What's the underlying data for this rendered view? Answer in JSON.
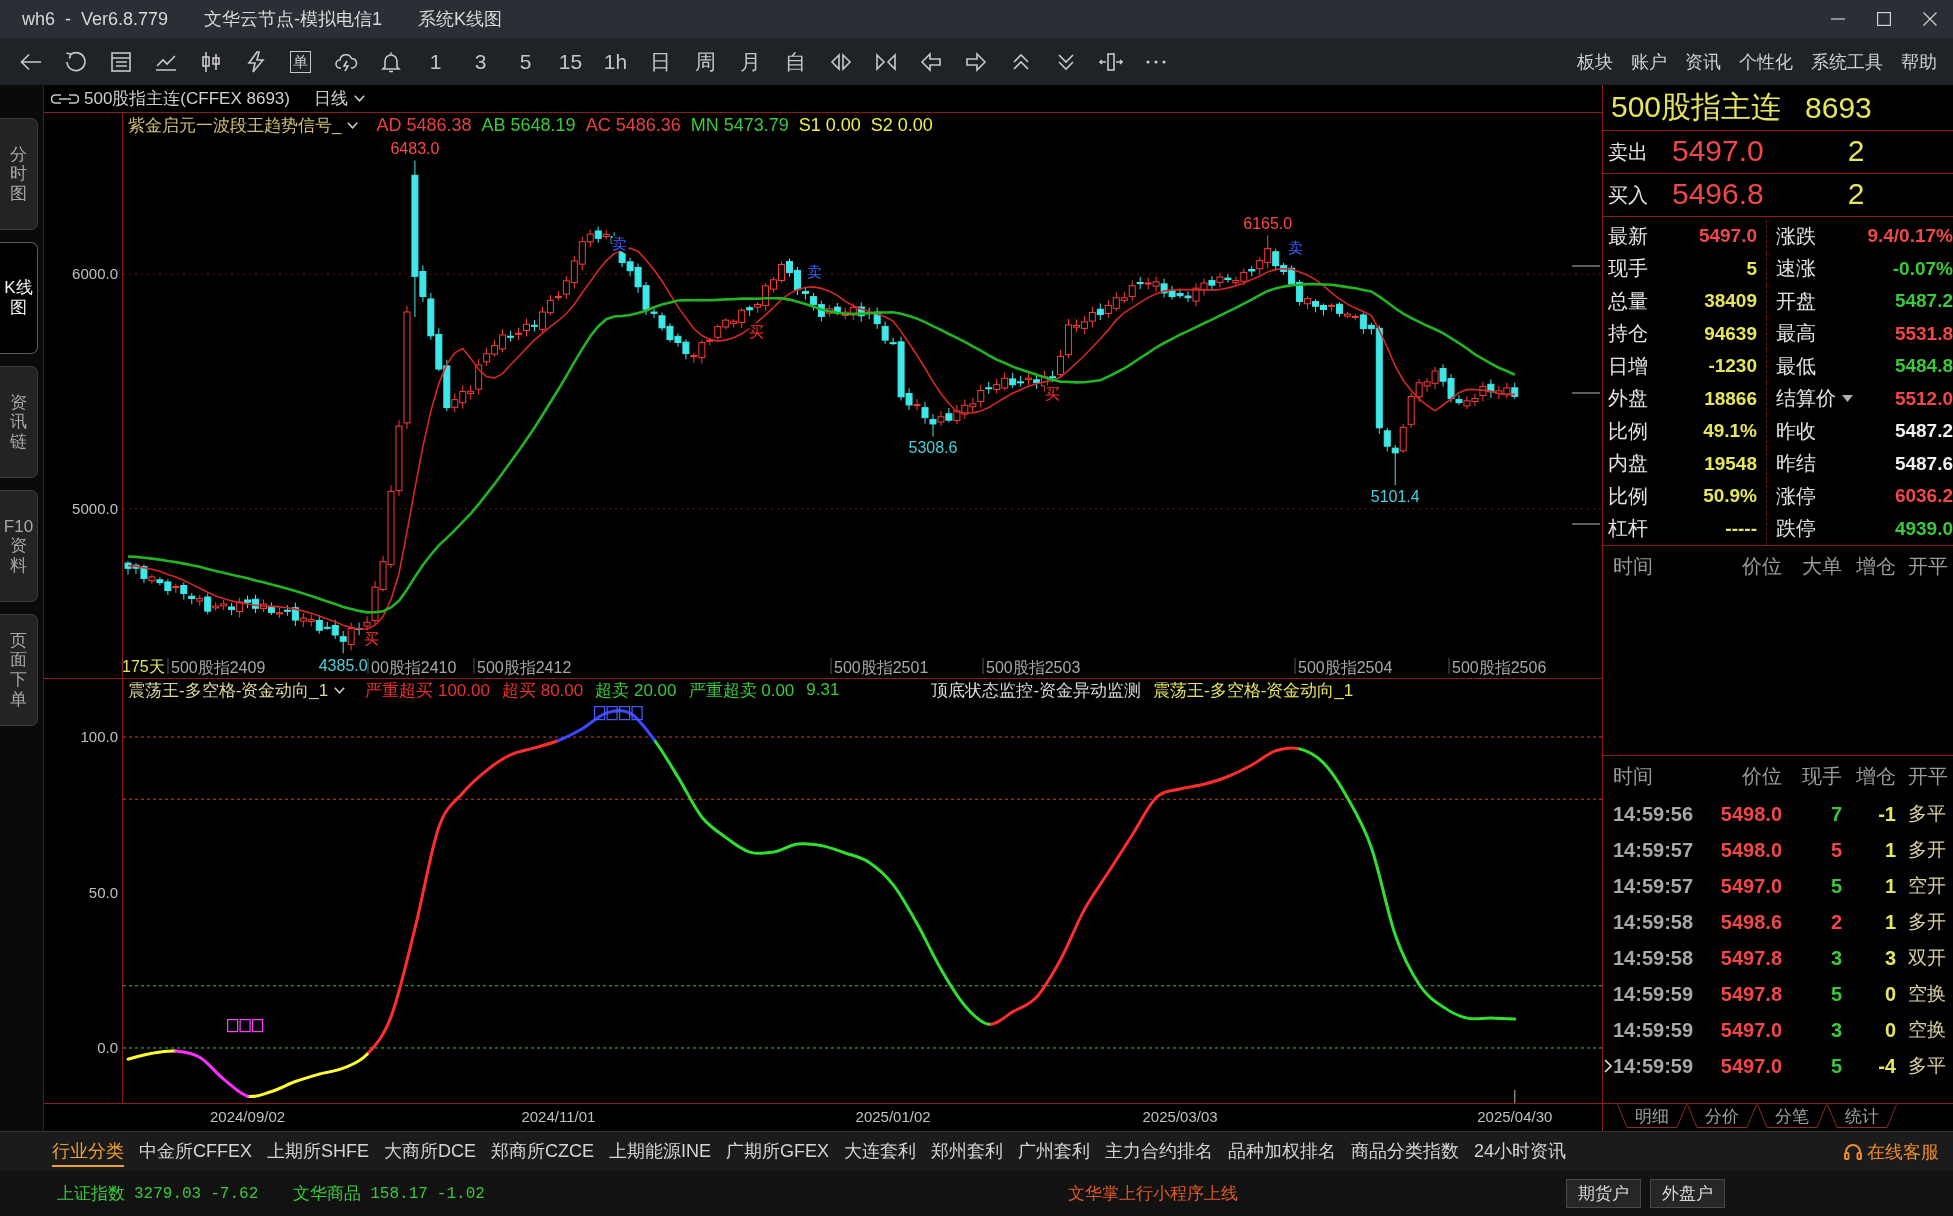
{
  "window": {
    "title_parts": [
      "wh6  -  Ver6.8.779",
      "文华云节点-模拟电信1",
      "系统K线图"
    ]
  },
  "toolbar": {
    "order_label": "单",
    "periods": [
      "1",
      "3",
      "5",
      "15",
      "1h",
      "日",
      "周",
      "月",
      "自"
    ],
    "menu": [
      "板块",
      "账户",
      "资讯",
      "个性化",
      "系统工具",
      "帮助"
    ]
  },
  "side_tabs": [
    {
      "label": "分时图",
      "selected": false
    },
    {
      "label": "K线图",
      "selected": true
    },
    {
      "label": "资讯链",
      "selected": false
    },
    {
      "label": "F10资料",
      "selected": false
    },
    {
      "label": "页面下单",
      "selected": false
    }
  ],
  "chart_header": {
    "symbol": "500股指主连(CFFEX 8693)",
    "period": "日线"
  },
  "main_chart": {
    "indicator": "紫金启元一波段王趋势信号_",
    "values": [
      {
        "text": "AD 5486.38",
        "color": "#e84040"
      },
      {
        "text": "AB 5648.19",
        "color": "#3cc83c"
      },
      {
        "text": "AC 5486.36",
        "color": "#e84040"
      },
      {
        "text": "MN 5473.79",
        "color": "#3cc83c"
      },
      {
        "text": "S1 0.00",
        "color": "#f0f040"
      },
      {
        "text": "S2 0.00",
        "color": "#f0f040"
      }
    ],
    "y_labels": [
      "6000.0",
      "5000.0"
    ],
    "bar_count": "175天",
    "contracts": [
      "500股指2409",
      "00股指2410",
      "500股指2412",
      "500股指2501",
      "500股指2503",
      "500股指2504",
      "500股指2506"
    ],
    "price_labels": [
      {
        "text": "6483.0",
        "kind": "high"
      },
      {
        "text": "4385.0",
        "kind": "low"
      },
      {
        "text": "5308.6",
        "kind": "low"
      },
      {
        "text": "6165.0",
        "kind": "high"
      },
      {
        "text": "5101.4",
        "kind": "low"
      }
    ],
    "signals": [
      {
        "text": "买",
        "kind": "buy"
      },
      {
        "text": "卖",
        "kind": "sell"
      },
      {
        "text": "买",
        "kind": "buy"
      },
      {
        "text": "卖",
        "kind": "sell"
      },
      {
        "text": "买",
        "kind": "buy"
      },
      {
        "text": "卖",
        "kind": "sell"
      }
    ]
  },
  "sub_chart": {
    "chart_data": {
      "type": "line",
      "title": "震荡王-多空格-资金动向_1",
      "categories": [
        null,
        null,
        null,
        null,
        null,
        "2024/09/02",
        null,
        null,
        null,
        null,
        null,
        null,
        null,
        null,
        null,
        null,
        null,
        null,
        "2024/11/01",
        null,
        null,
        null,
        null,
        null,
        null,
        null,
        null,
        null,
        null,
        null,
        null,
        null,
        "2025/01/02",
        null,
        null,
        null,
        null,
        null,
        null,
        null,
        null,
        null,
        null,
        null,
        "2025/03/03",
        null,
        null,
        null,
        null,
        null,
        null,
        null,
        null,
        null,
        null,
        null,
        null,
        null,
        "2025/04/30"
      ],
      "series": [
        {
          "name": "震荡王-多空格-资金动向_1",
          "color": "#ff2d2d",
          "values": [
            null,
            null,
            null,
            null,
            null,
            null,
            null,
            null,
            null,
            null,
            -2,
            10,
            38.4,
            71,
            82,
            89.3,
            94.3,
            96.5,
            98.9,
            null,
            null,
            null,
            null,
            null,
            null,
            null,
            null,
            null,
            null,
            null,
            null,
            null,
            null,
            null,
            null,
            null,
            7.6,
            11.6,
            16.4,
            28.4,
            44.5,
            56.5,
            68.5,
            80.5,
            83.3,
            84.8,
            87.3,
            91,
            95.6,
            96.2,
            null,
            null,
            null,
            null,
            null,
            null,
            null,
            null,
            null
          ]
        },
        {
          "color": "#30e030",
          "values": [
            null,
            null,
            null,
            null,
            null,
            null,
            null,
            null,
            null,
            null,
            null,
            null,
            null,
            null,
            null,
            null,
            null,
            null,
            null,
            null,
            null,
            null,
            99.2,
            87.2,
            74.3,
            67.7,
            63,
            63,
            65.6,
            65.1,
            62.7,
            59.7,
            52.5,
            40,
            25.3,
            13.6,
            7.6,
            null,
            null,
            null,
            null,
            null,
            null,
            null,
            null,
            null,
            null,
            null,
            null,
            96.2,
            91.7,
            80.5,
            64.5,
            36.4,
            20.4,
            13.2,
            9.6,
            9.6,
            9.3
          ]
        },
        {
          "color": "#ffff30",
          "values": [
            -3.6,
            -1.7,
            -1,
            null,
            null,
            -15.5,
            -14,
            -10.8,
            -8.4,
            -6.5,
            -2,
            null,
            null,
            null,
            null,
            null,
            null,
            null,
            null,
            null,
            null,
            null,
            null,
            null,
            null,
            null,
            null,
            null,
            null,
            null,
            null,
            null,
            null,
            null,
            null,
            null,
            null,
            null,
            null,
            null,
            null,
            null,
            null,
            null,
            null,
            null,
            null,
            null,
            null,
            null,
            null,
            null,
            null,
            null,
            null,
            null,
            null,
            null,
            null
          ]
        },
        {
          "color": "#ff30ff",
          "values": [
            null,
            null,
            -1,
            -3,
            -10,
            -15.5,
            null,
            null,
            null,
            null,
            null,
            null,
            null,
            null,
            null,
            null,
            null,
            null,
            null,
            null,
            null,
            null,
            null,
            null,
            null,
            null,
            null,
            null,
            null,
            null,
            null,
            null,
            null,
            null,
            null,
            null,
            null,
            null,
            null,
            null,
            null,
            null,
            null,
            null,
            null,
            null,
            null,
            null,
            null,
            null,
            null,
            null,
            null,
            null,
            null,
            null,
            null,
            null,
            null
          ]
        },
        {
          "color": "#3c48ff",
          "values": [
            null,
            null,
            null,
            null,
            null,
            null,
            null,
            null,
            null,
            null,
            null,
            null,
            null,
            null,
            null,
            null,
            null,
            null,
            98.9,
            102.7,
            107.7,
            107.7,
            99.2,
            null,
            null,
            null,
            null,
            null,
            null,
            null,
            null,
            null,
            null,
            null,
            null,
            null,
            null,
            null,
            null,
            null,
            null,
            null,
            null,
            null,
            null,
            null,
            null,
            null,
            null,
            null,
            null,
            null,
            null,
            null,
            null,
            null,
            null,
            null,
            null
          ]
        }
      ],
      "ylim": [
        -17.7,
        111.6
      ],
      "yticks": [
        {
          "value": 0,
          "label": "0.0"
        },
        {
          "value": 50,
          "label": "50.0"
        },
        {
          "value": 100,
          "label": "100.0"
        }
      ],
      "ref_lines": [
        {
          "axis": "y",
          "value": 100
        },
        {
          "axis": "y",
          "value": 80
        },
        {
          "axis": "y",
          "value": 20
        },
        {
          "axis": "y",
          "value": 0
        }
      ]
    },
    "levels": [
      {
        "text": "严重超买 100.00",
        "color": "#e83030"
      },
      {
        "text": "超买 80.00",
        "color": "#e83030"
      },
      {
        "text": "超卖 20.00",
        "color": "#3cc83c"
      },
      {
        "text": "严重超卖 0.00",
        "color": "#3cc83c"
      }
    ],
    "current": "9.31",
    "monitor": "顶底状态监控-资金异动监测"
  },
  "quote": {
    "name": "500股指主连",
    "code": "8693",
    "book": [
      {
        "label": "卖出",
        "price": "5497.0",
        "volume": "2"
      },
      {
        "label": "买入",
        "price": "5496.8",
        "volume": "2"
      }
    ],
    "stats": [
      {
        "cells": [
          {
            "label": "最新",
            "value": "5497.0",
            "color": "#f04848",
            "dropdown": false
          },
          {
            "label": "涨跌",
            "value": "9.4/0.17%",
            "color": "#f04848",
            "dropdown": false
          }
        ]
      },
      {
        "cells": [
          {
            "label": "现手",
            "value": "5",
            "color": "#e6e65c",
            "dropdown": false
          },
          {
            "label": "速涨",
            "value": "-0.07%",
            "color": "#3cc83c",
            "dropdown": false
          }
        ]
      },
      {
        "cells": [
          {
            "label": "总量",
            "value": "38409",
            "color": "#e6e65c",
            "dropdown": false
          },
          {
            "label": "开盘",
            "value": "5487.2",
            "color": "#3cc83c",
            "dropdown": false
          }
        ]
      },
      {
        "cells": [
          {
            "label": "持仓",
            "value": "94639",
            "color": "#e6e65c",
            "dropdown": false
          },
          {
            "label": "最高",
            "value": "5531.8",
            "color": "#f04848",
            "dropdown": false
          }
        ]
      },
      {
        "cells": [
          {
            "label": "日增",
            "value": "-1230",
            "color": "#e6e65c",
            "dropdown": false
          },
          {
            "label": "最低",
            "value": "5484.8",
            "color": "#3cc83c",
            "dropdown": false
          }
        ]
      },
      {
        "cells": [
          {
            "label": "外盘",
            "value": "18866",
            "color": "#e6e65c",
            "dropdown": false
          },
          {
            "label": "结算价",
            "value": "5512.0",
            "color": "#f04848",
            "dropdown": true
          }
        ]
      },
      {
        "cells": [
          {
            "label": "比例",
            "value": "49.1%",
            "color": "#e6e65c",
            "dropdown": false
          },
          {
            "label": "昨收",
            "value": "5487.2",
            "color": "#f0f0f0",
            "dropdown": false
          }
        ]
      },
      {
        "cells": [
          {
            "label": "内盘",
            "value": "19548",
            "color": "#e6e65c",
            "dropdown": false
          },
          {
            "label": "昨结",
            "value": "5487.6",
            "color": "#f0f0f0",
            "dropdown": false
          }
        ]
      },
      {
        "cells": [
          {
            "label": "比例",
            "value": "50.9%",
            "color": "#e6e65c",
            "dropdown": false
          },
          {
            "label": "涨停",
            "value": "6036.2",
            "color": "#f04848",
            "dropdown": false
          }
        ]
      },
      {
        "cells": [
          {
            "label": "杠杆",
            "value": "-----",
            "color": "#e6e65c",
            "dropdown": false
          },
          {
            "label": "跌停",
            "value": "4939.0",
            "color": "#3cc83c",
            "dropdown": false
          }
        ]
      }
    ]
  },
  "big_orders": {
    "columns": [
      "时间",
      "价位",
      "大单",
      "增仓",
      "开平"
    ]
  },
  "ticks": {
    "columns": [
      "时间",
      "价位",
      "现手",
      "增仓",
      "开平"
    ],
    "rows": [
      {
        "time": "14:59:56",
        "price": "5498.0",
        "volume": "7",
        "color": "#3cc83c",
        "change": "-1",
        "action": "多平",
        "selected": false
      },
      {
        "time": "14:59:57",
        "price": "5498.0",
        "volume": "5",
        "color": "#f04848",
        "change": "1",
        "action": "多开",
        "selected": false
      },
      {
        "time": "14:59:57",
        "price": "5497.0",
        "volume": "5",
        "color": "#3cc83c",
        "change": "1",
        "action": "空开",
        "selected": false
      },
      {
        "time": "14:59:58",
        "price": "5498.6",
        "volume": "2",
        "color": "#f04848",
        "change": "1",
        "action": "多开",
        "selected": false
      },
      {
        "time": "14:59:58",
        "price": "5497.8",
        "volume": "3",
        "color": "#3cc83c",
        "change": "3",
        "action": "双开",
        "selected": false
      },
      {
        "time": "14:59:59",
        "price": "5497.8",
        "volume": "5",
        "color": "#3cc83c",
        "change": "0",
        "action": "空换",
        "selected": false
      },
      {
        "time": "14:59:59",
        "price": "5497.0",
        "volume": "3",
        "color": "#3cc83c",
        "change": "0",
        "action": "空换",
        "selected": false
      },
      {
        "time": "14:59:59",
        "price": "5497.0",
        "volume": "5",
        "color": "#3cc83c",
        "change": "-4",
        "action": "多平",
        "selected": true
      }
    ],
    "tabs": [
      "明细",
      "分价",
      "分笔",
      "统计"
    ]
  },
  "bottom_tabs": {
    "items": [
      {
        "label": "行业分类",
        "selected": true
      },
      {
        "label": "中金所CFFEX",
        "selected": false
      },
      {
        "label": "上期所SHFE",
        "selected": false
      },
      {
        "label": "大商所DCE",
        "selected": false
      },
      {
        "label": "郑商所CZCE",
        "selected": false
      },
      {
        "label": "上期能源INE",
        "selected": false
      },
      {
        "label": "广期所GFEX",
        "selected": false
      },
      {
        "label": "大连套利",
        "selected": false
      },
      {
        "label": "郑州套利",
        "selected": false
      },
      {
        "label": "广州套利",
        "selected": false
      },
      {
        "label": "主力合约排名",
        "selected": false
      },
      {
        "label": "品种加权排名",
        "selected": false
      },
      {
        "label": "商品分类指数",
        "selected": false
      },
      {
        "label": "24小时资讯",
        "selected": false
      }
    ],
    "service": "在线客服"
  },
  "status_bar": {
    "indices": [
      {
        "name": "上证指数",
        "value": "3279.03",
        "change": "-7.62",
        "color": "#3cc83c"
      },
      {
        "name": "文华商品",
        "value": "158.17",
        "change": "-1.02",
        "color": "#3cc83c"
      }
    ],
    "notice": "文华掌上行小程序上线",
    "buttons": [
      "期货户",
      "外盘户"
    ]
  }
}
